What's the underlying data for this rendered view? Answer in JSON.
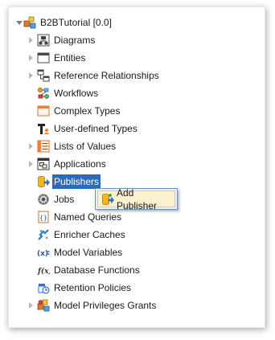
{
  "tree": {
    "root_label": "B2BTutorial [0.0]",
    "items": [
      {
        "label": "Diagrams",
        "icon": "diagram-icon"
      },
      {
        "label": "Entities",
        "icon": "entity-table-icon"
      },
      {
        "label": "Reference Relationships",
        "icon": "reference-relationship-icon"
      },
      {
        "label": "Workflows",
        "icon": "workflow-icon"
      },
      {
        "label": "Complex Types",
        "icon": "complex-type-icon"
      },
      {
        "label": "User-defined Types",
        "icon": "user-defined-type-icon"
      },
      {
        "label": "Lists of Values",
        "icon": "list-of-values-icon"
      },
      {
        "label": "Applications",
        "icon": "application-icon"
      },
      {
        "label": "Publishers",
        "icon": "publisher-icon",
        "selected": true
      },
      {
        "label": "Jobs",
        "icon": "gear-icon"
      },
      {
        "label": "Named Queries",
        "icon": "named-query-icon"
      },
      {
        "label": "Enricher Caches",
        "icon": "enricher-cache-icon"
      },
      {
        "label": "Model Variables",
        "icon": "model-variable-icon"
      },
      {
        "label": "Database Functions",
        "icon": "database-function-icon"
      },
      {
        "label": "Retention Policies",
        "icon": "retention-policy-icon"
      },
      {
        "label": "Model Privileges Grants",
        "icon": "privilege-grant-icon"
      }
    ]
  },
  "context_menu": {
    "add_publisher_label": "Add Publisher",
    "icon": "add-publisher-icon"
  },
  "colors": {
    "selection": "#2c6bb5",
    "menu_highlight": "#fbf1cf",
    "menu_border": "#6f8fb8"
  }
}
